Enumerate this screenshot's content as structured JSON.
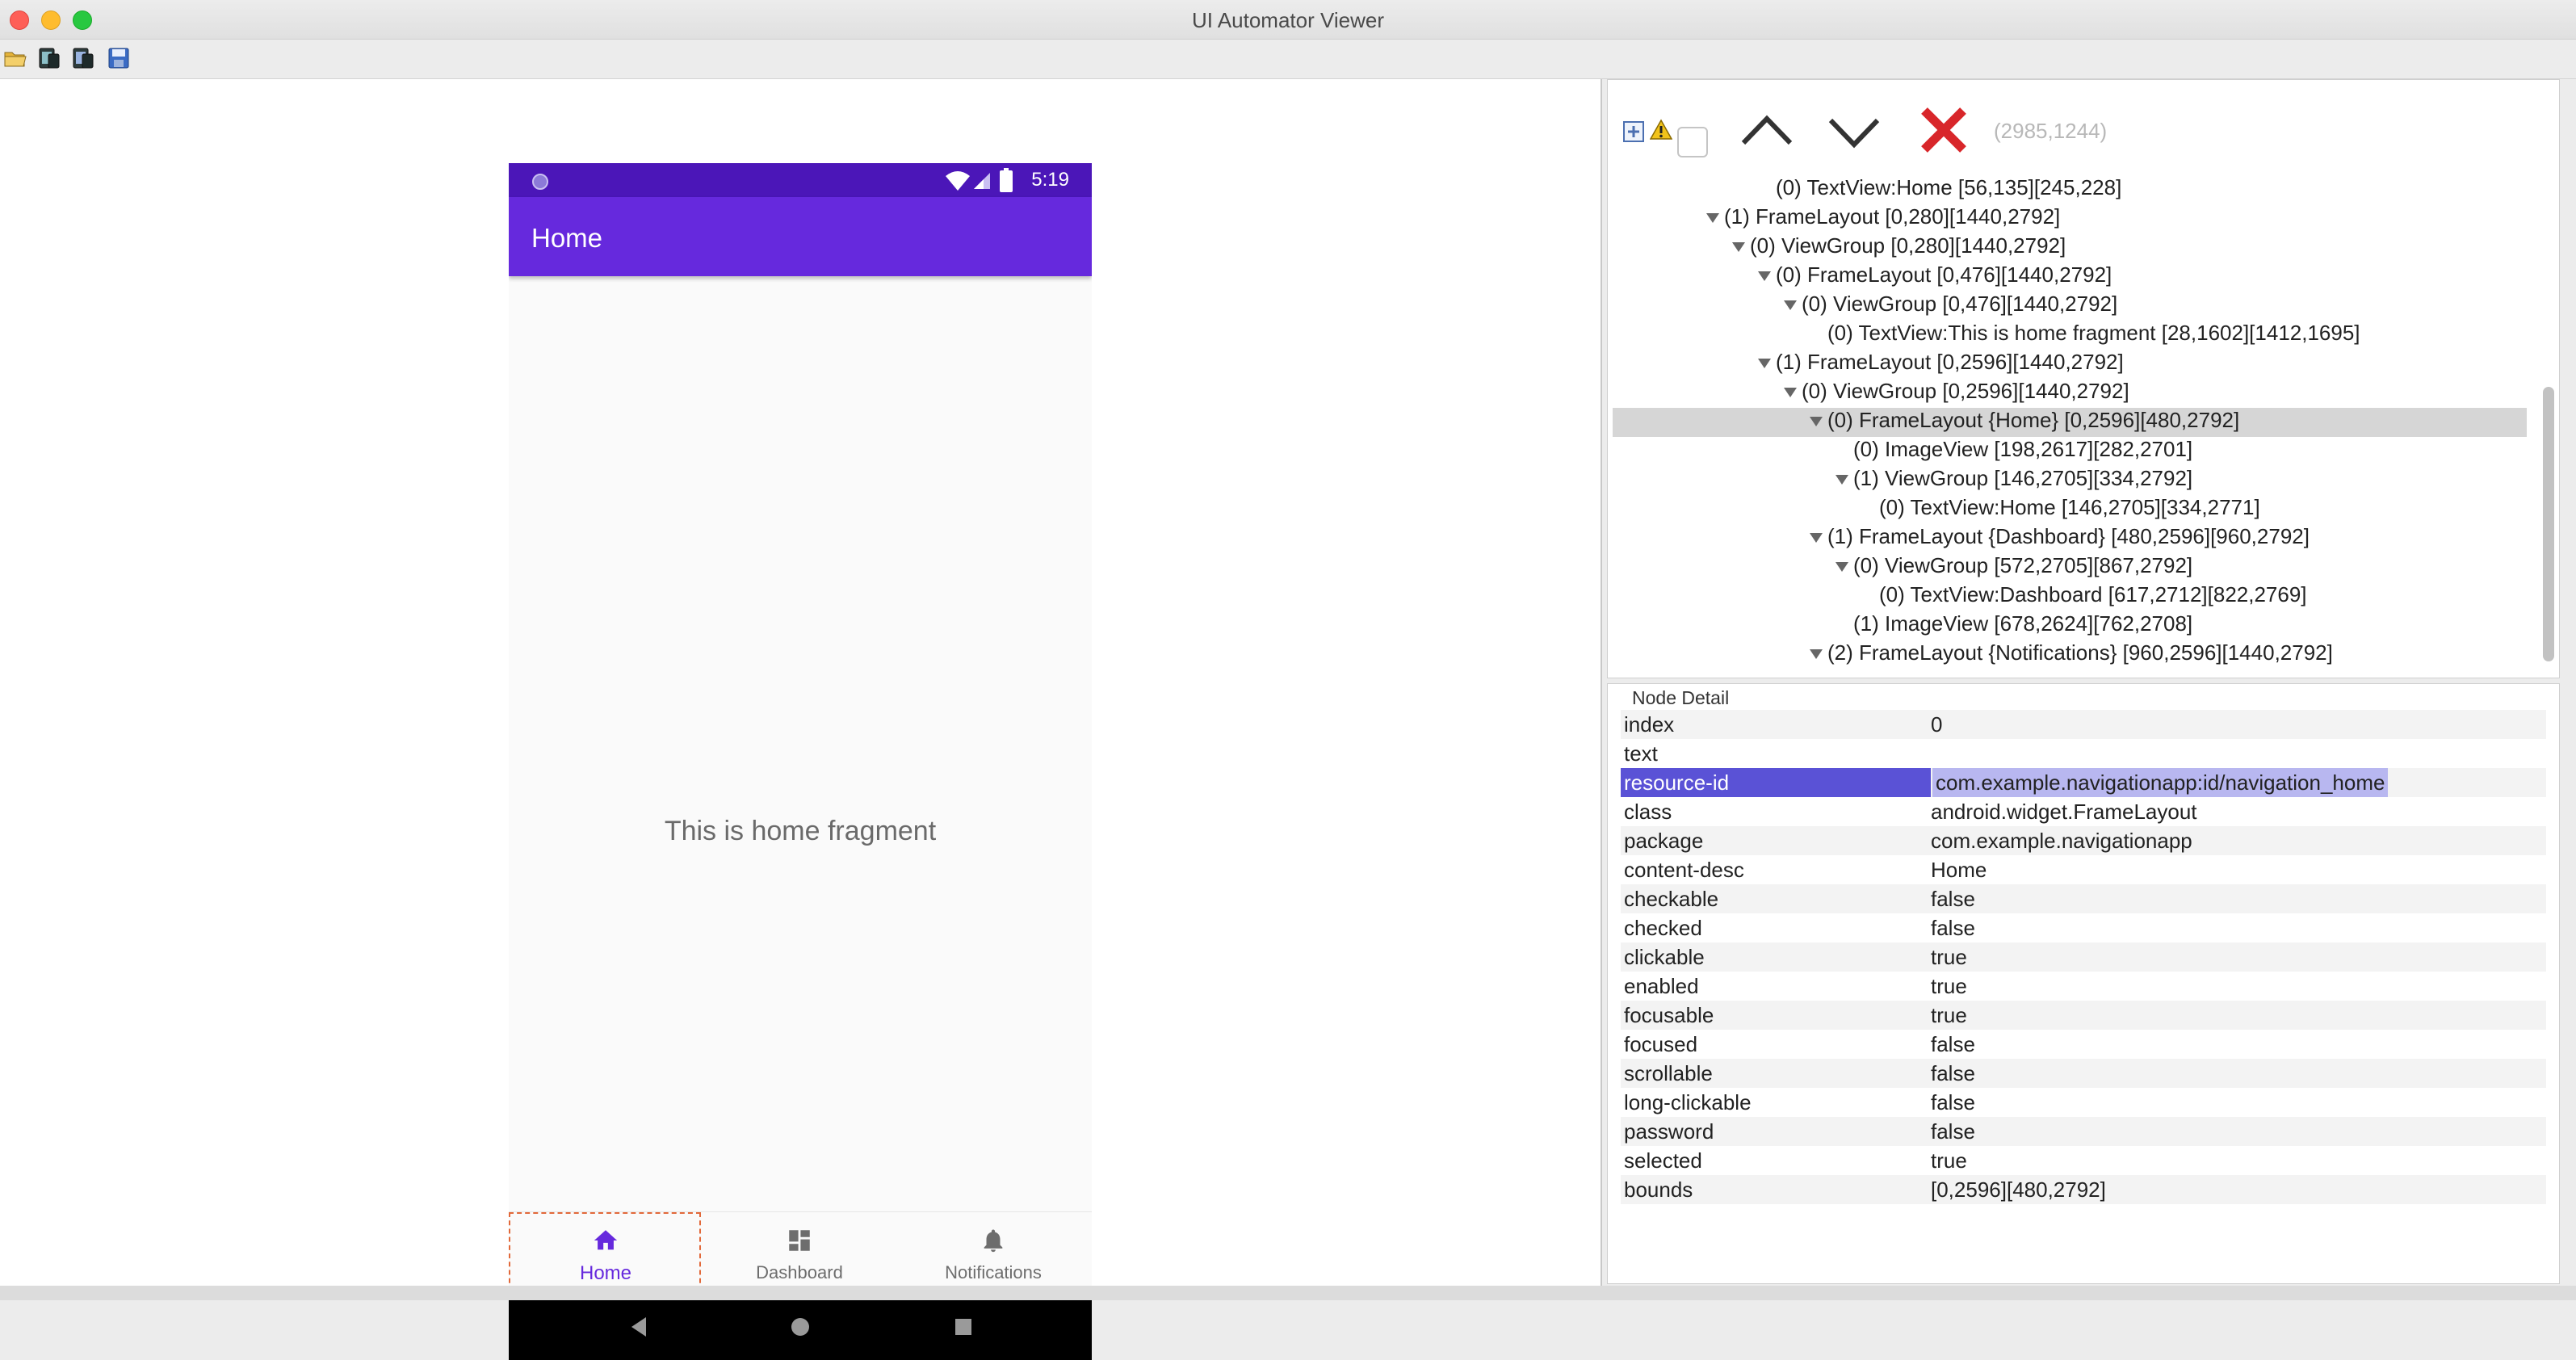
{
  "window": {
    "title": "UI Automator Viewer"
  },
  "toolbar": {
    "icons": [
      "open-folder-icon",
      "device-screenshot-icon",
      "device-screenshot-compressed-icon",
      "save-icon"
    ]
  },
  "device": {
    "status_time": "5:19",
    "app_title": "Home",
    "fragment_text": "This is home fragment",
    "nav": [
      {
        "label": "Home",
        "icon": "home-icon",
        "active": true
      },
      {
        "label": "Dashboard",
        "icon": "dashboard-icon",
        "active": false
      },
      {
        "label": "Notifications",
        "icon": "bell-icon",
        "active": false
      }
    ]
  },
  "tree": {
    "coords": "(2985,1244)",
    "rows": [
      {
        "text": "(0) TextView:Home [56,135][245,228]",
        "level": 7,
        "expander": false
      },
      {
        "text": "(1) FrameLayout [0,280][1440,2792]",
        "level": 5,
        "expander": true
      },
      {
        "text": "(0) ViewGroup [0,280][1440,2792]",
        "level": 6,
        "expander": true
      },
      {
        "text": "(0) FrameLayout [0,476][1440,2792]",
        "level": 7,
        "expander": true
      },
      {
        "text": "(0) ViewGroup [0,476][1440,2792]",
        "level": 8,
        "expander": true
      },
      {
        "text": "(0) TextView:This is home fragment [28,1602][1412,1695]",
        "level": 9,
        "expander": false
      },
      {
        "text": "(1) FrameLayout [0,2596][1440,2792]",
        "level": 7,
        "expander": true
      },
      {
        "text": "(0) ViewGroup [0,2596][1440,2792]",
        "level": 8,
        "expander": true
      },
      {
        "text": "(0) FrameLayout {Home} [0,2596][480,2792]",
        "level": 9,
        "expander": true,
        "selected": true
      },
      {
        "text": "(0) ImageView [198,2617][282,2701]",
        "level": 10,
        "expander": false
      },
      {
        "text": "(1) ViewGroup [146,2705][334,2792]",
        "level": 10,
        "expander": true
      },
      {
        "text": "(0) TextView:Home [146,2705][334,2771]",
        "level": 11,
        "expander": false
      },
      {
        "text": "(1) FrameLayout {Dashboard} [480,2596][960,2792]",
        "level": 9,
        "expander": true
      },
      {
        "text": "(0) ViewGroup [572,2705][867,2792]",
        "level": 10,
        "expander": true
      },
      {
        "text": "(0) TextView:Dashboard [617,2712][822,2769]",
        "level": 11,
        "expander": false
      },
      {
        "text": "(1) ImageView [678,2624][762,2708]",
        "level": 10,
        "expander": false
      },
      {
        "text": "(2) FrameLayout {Notifications} [960,2596][1440,2792]",
        "level": 9,
        "expander": true
      }
    ]
  },
  "node_detail": {
    "title": "Node Detail",
    "rows": [
      {
        "key": "index",
        "value": "0"
      },
      {
        "key": "text",
        "value": ""
      },
      {
        "key": "resource-id",
        "value": "com.example.navigationapp:id/navigation_home",
        "highlight": true
      },
      {
        "key": "class",
        "value": "android.widget.FrameLayout"
      },
      {
        "key": "package",
        "value": "com.example.navigationapp"
      },
      {
        "key": "content-desc",
        "value": "Home"
      },
      {
        "key": "checkable",
        "value": "false"
      },
      {
        "key": "checked",
        "value": "false"
      },
      {
        "key": "clickable",
        "value": "true"
      },
      {
        "key": "enabled",
        "value": "true"
      },
      {
        "key": "focusable",
        "value": "true"
      },
      {
        "key": "focused",
        "value": "false"
      },
      {
        "key": "scrollable",
        "value": "false"
      },
      {
        "key": "long-clickable",
        "value": "false"
      },
      {
        "key": "password",
        "value": "false"
      },
      {
        "key": "selected",
        "value": "true"
      },
      {
        "key": "bounds",
        "value": "[0,2596][480,2792]"
      },
      {
        "key": "",
        "value": ""
      }
    ]
  },
  "colors": {
    "accent": "#6629dd",
    "status_bar": "#4b16b8",
    "selection": "#5a52d6",
    "nav_outline": "#e2693a"
  }
}
